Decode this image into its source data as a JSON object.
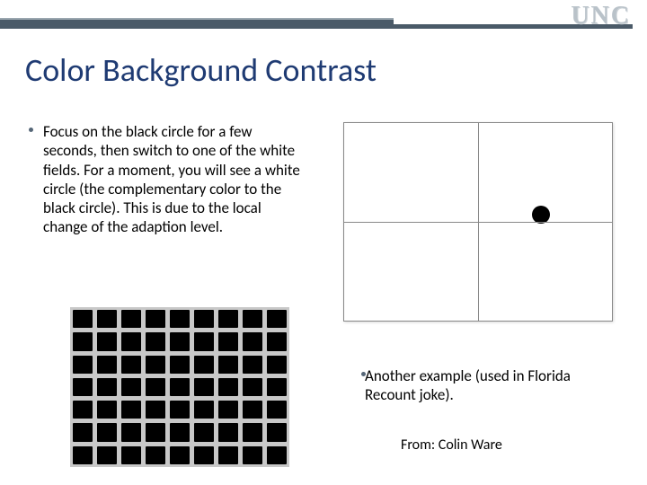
{
  "brand": "UNC",
  "title": "Color Background Contrast",
  "bullets": {
    "left": "Focus on the black circle for a few seconds, then switch to one of the white fields. For a moment, you will see a white circle (the complementary color to the black circle). This is due to the local change of the adaption level.",
    "right": "Another example (used in Florida Recount joke)."
  },
  "attribution": "From: Colin Ware",
  "grid": {
    "cols": 9,
    "rows": 7
  }
}
